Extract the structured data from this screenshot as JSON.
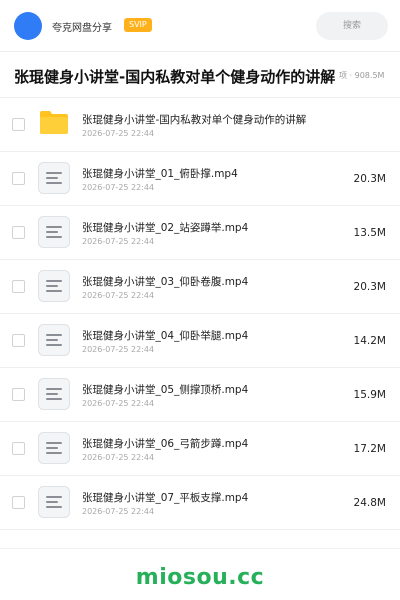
{
  "header": {
    "app_name": "夸克网盘分享",
    "badge": "SVIP",
    "search_placeholder": "搜索",
    "avatar_color": "#2f7cf6",
    "badge_color": "#ffb11b"
  },
  "share": {
    "title": "张琨健身小讲堂-国内私教对单个健身动作的讲解",
    "meta": "项 · 908.5M"
  },
  "files": [
    {
      "icon": "folder-icon",
      "name": "张琨健身小讲堂-国内私教对单个健身动作的讲解",
      "date": "2026-07-25 22:44",
      "size": ""
    },
    {
      "icon": "file-icon",
      "name": "张琨健身小讲堂_01_俯卧撑.mp4",
      "date": "2026-07-25 22:44",
      "size": "20.3M"
    },
    {
      "icon": "file-icon",
      "name": "张琨健身小讲堂_02_站姿蹲举.mp4",
      "date": "2026-07-25 22:44",
      "size": "13.5M"
    },
    {
      "icon": "file-icon",
      "name": "张琨健身小讲堂_03_仰卧卷腹.mp4",
      "date": "2026-07-25 22:44",
      "size": "20.3M"
    },
    {
      "icon": "file-icon",
      "name": "张琨健身小讲堂_04_仰卧举腿.mp4",
      "date": "2026-07-25 22:44",
      "size": "14.2M"
    },
    {
      "icon": "file-icon",
      "name": "张琨健身小讲堂_05_侧撑顶桥.mp4",
      "date": "2026-07-25 22:44",
      "size": "15.9M"
    },
    {
      "icon": "file-icon",
      "name": "张琨健身小讲堂_06_弓箭步蹲.mp4",
      "date": "2026-07-25 22:44",
      "size": "17.2M"
    },
    {
      "icon": "file-icon",
      "name": "张琨健身小讲堂_07_平板支撑.mp4",
      "date": "2026-07-25 22:44",
      "size": "24.8M"
    }
  ],
  "footer": {
    "watermark": "miosou.cc",
    "watermark_color": "#26b05a"
  }
}
